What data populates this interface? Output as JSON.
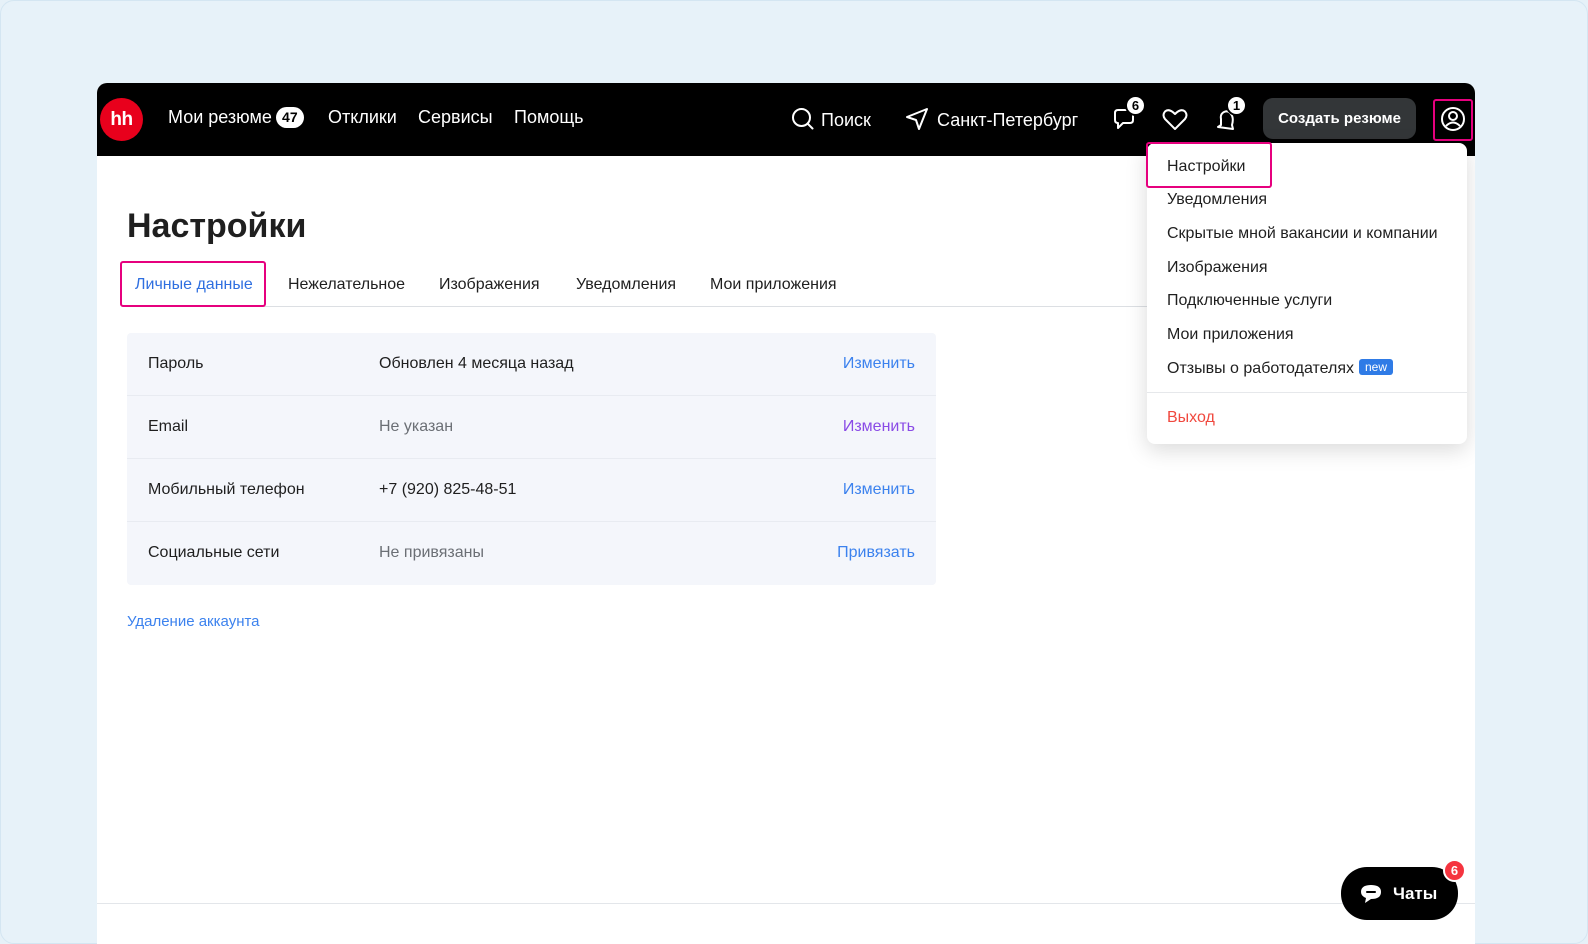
{
  "header": {
    "logo_text": "hh",
    "nav": {
      "resumes_label": "Мои резюме",
      "resumes_count": "47",
      "responses_label": "Отклики",
      "services_label": "Сервисы",
      "help_label": "Помощь"
    },
    "search_label": "Поиск",
    "city_label": "Санкт-Петербург",
    "messages_count": "6",
    "notifications_count": "1",
    "create_resume_label": "Создать резюме"
  },
  "page": {
    "title": "Настройки",
    "tabs": [
      {
        "label": "Личные данные"
      },
      {
        "label": "Нежелательное"
      },
      {
        "label": "Изображения"
      },
      {
        "label": "Уведомления"
      },
      {
        "label": "Мои приложения"
      }
    ],
    "rows": [
      {
        "label": "Пароль",
        "value": "Обновлен 4 месяца назад",
        "action": "Изменить"
      },
      {
        "label": "Email",
        "value": "Не указан",
        "action": "Изменить"
      },
      {
        "label": "Мобильный телефон",
        "value": "+7 (920) 825-48-51",
        "action": "Изменить"
      },
      {
        "label": "Социальные сети",
        "value": "Не привязаны",
        "action": "Привязать"
      }
    ],
    "delete_account_label": "Удаление аккаунта"
  },
  "dropdown": {
    "items": [
      {
        "label": "Настройки"
      },
      {
        "label": "Уведомления"
      },
      {
        "label": "Скрытые мной вакансии и компании"
      },
      {
        "label": "Изображения"
      },
      {
        "label": "Подключенные услуги"
      },
      {
        "label": "Мои приложения"
      },
      {
        "label": "Отзывы о работодателях",
        "badge": "new"
      }
    ],
    "logout_label": "Выход"
  },
  "chat": {
    "label": "Чаты",
    "count": "6"
  },
  "colors": {
    "brand_red": "#e8001c",
    "highlight_magenta": "#e6007e",
    "link_blue": "#3c82ee",
    "logout_red": "#f0483e"
  },
  "icons": [
    "search-icon",
    "location-arrow-icon",
    "chat-bubble-icon",
    "heart-icon",
    "bell-icon",
    "user-circle-icon",
    "chat-icon"
  ]
}
